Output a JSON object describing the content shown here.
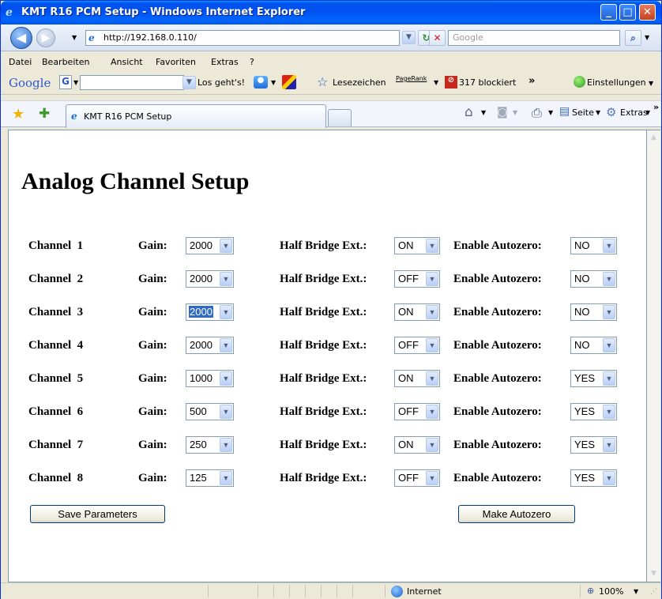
{
  "window": {
    "title": "KMT R16 PCM Setup - Windows Internet Explorer",
    "minimize_label": "_",
    "maximize_label": "□",
    "close_label": "✕"
  },
  "address_bar": {
    "url": "http://192.168.0.110/",
    "search_placeholder": "Google"
  },
  "menu": [
    "Datei",
    "Bearbeiten",
    "Ansicht",
    "Favoriten",
    "Extras",
    "?"
  ],
  "google_toolbar": {
    "logo": "Google",
    "go_label": "Los geht's!",
    "bookmarks_label": "Lesezeichen",
    "pagerank_label": "PageRank",
    "blocked_label": "317 blockiert",
    "settings_label": "Einstellungen"
  },
  "tab": {
    "title": "KMT R16 PCM Setup"
  },
  "command_bar": {
    "page_label": "Seite",
    "tools_label": "Extras"
  },
  "page": {
    "title": "Analog Channel Setup",
    "gain_label": "Gain:",
    "half_bridge_label": "Half Bridge Ext.:",
    "autozero_label": "Enable Autozero:",
    "channels": [
      {
        "name": "Channel  1",
        "gain": "2000",
        "half_bridge": "ON",
        "autozero": "NO"
      },
      {
        "name": "Channel  2",
        "gain": "2000",
        "half_bridge": "OFF",
        "autozero": "NO"
      },
      {
        "name": "Channel  3",
        "gain": "2000",
        "half_bridge": "ON",
        "autozero": "NO"
      },
      {
        "name": "Channel  4",
        "gain": "2000",
        "half_bridge": "OFF",
        "autozero": "NO"
      },
      {
        "name": "Channel  5",
        "gain": "1000",
        "half_bridge": "ON",
        "autozero": "YES"
      },
      {
        "name": "Channel  6",
        "gain": "500",
        "half_bridge": "OFF",
        "autozero": "YES"
      },
      {
        "name": "Channel  7",
        "gain": "250",
        "half_bridge": "ON",
        "autozero": "YES"
      },
      {
        "name": "Channel  8",
        "gain": "125",
        "half_bridge": "OFF",
        "autozero": "YES"
      }
    ],
    "save_button": "Save Parameters",
    "autozero_button": "Make Autozero"
  },
  "status_bar": {
    "zone": "Internet",
    "zoom": "100%"
  }
}
